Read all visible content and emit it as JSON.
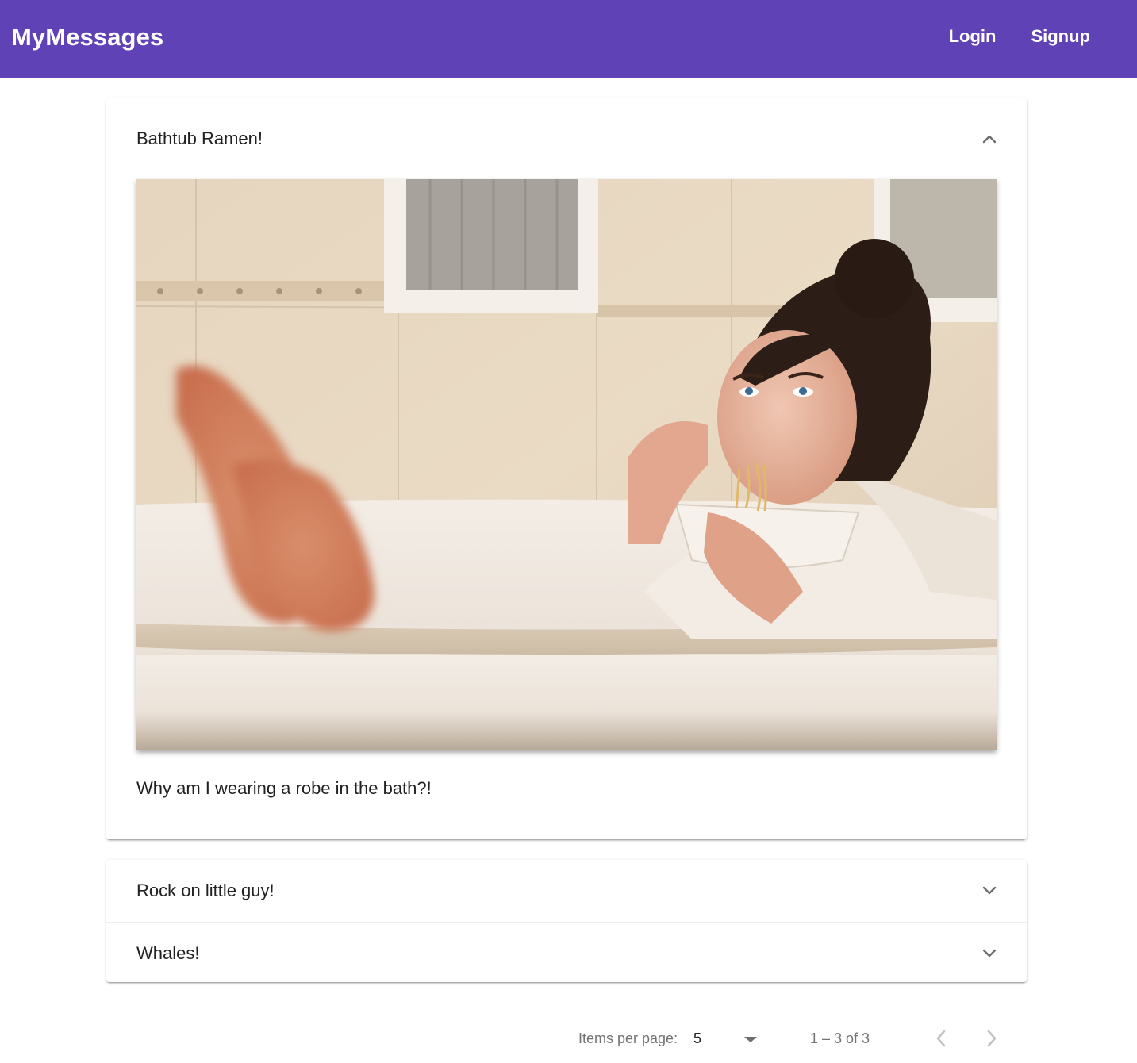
{
  "app": {
    "title": "MyMessages",
    "nav": {
      "login_label": "Login",
      "signup_label": "Signup"
    },
    "toolbar_color": "#5f42b5"
  },
  "posts": [
    {
      "title": "Bathtub Ramen!",
      "expanded": true,
      "image": "photo of a woman in a white robe in a bathtub eating noodles from a bowl, feet raised in the foreground",
      "content": "Why am I wearing a robe in the bath?!",
      "icon": "chevron-up-icon"
    },
    {
      "title": "Rock on little guy!",
      "expanded": false,
      "icon": "chevron-down-icon"
    },
    {
      "title": "Whales!",
      "expanded": false,
      "icon": "chevron-down-icon"
    }
  ],
  "paginator": {
    "items_per_page_label": "Items per page:",
    "page_size": "5",
    "range_label": "1 – 3 of 3",
    "prev_icon": "chevron-left-icon",
    "next_icon": "chevron-right-icon"
  }
}
